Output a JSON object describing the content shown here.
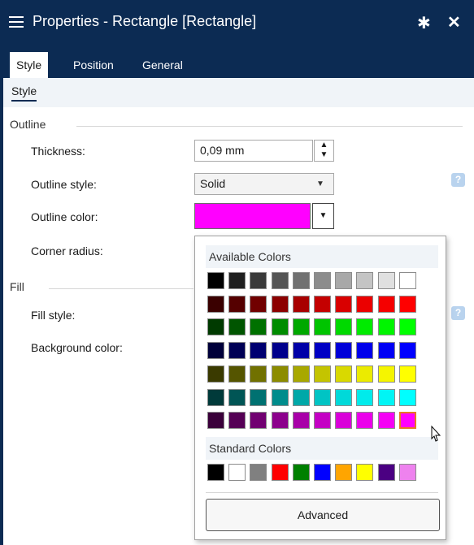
{
  "window": {
    "title": "Properties - Rectangle [Rectangle]",
    "pin_icon": "pin-icon",
    "close_icon": "close-icon"
  },
  "tabs": [
    {
      "label": "Style",
      "active": true
    },
    {
      "label": "Position",
      "active": false
    },
    {
      "label": "General",
      "active": false
    }
  ],
  "subtab": "Style",
  "outline": {
    "section_label": "Outline",
    "thickness_label": "Thickness:",
    "thickness_value": "0,09 mm",
    "style_label": "Outline style:",
    "style_value": "Solid",
    "color_label": "Outline color:",
    "color_value": "#ff00ff",
    "corner_label": "Corner radius:"
  },
  "fill": {
    "section_label": "Fill",
    "style_label": "Fill style:",
    "background_label": "Background color:"
  },
  "color_picker": {
    "available_label": "Available Colors",
    "standard_label": "Standard Colors",
    "advanced_label": "Advanced",
    "available_colors": [
      [
        "#000000",
        "#1f1f1f",
        "#3a3a3a",
        "#555555",
        "#717171",
        "#8c8c8c",
        "#a8a8a8",
        "#c4c4c4",
        "#e0e0e0",
        "#ffffff"
      ],
      [
        "#3a0000",
        "#550000",
        "#710000",
        "#8c0000",
        "#a80000",
        "#c40000",
        "#d90000",
        "#eb0000",
        "#f50000",
        "#ff0000"
      ],
      [
        "#003a00",
        "#005500",
        "#007100",
        "#008c00",
        "#00a800",
        "#00c400",
        "#00d900",
        "#00eb00",
        "#00f500",
        "#00ff00"
      ],
      [
        "#00003a",
        "#000055",
        "#000071",
        "#00008c",
        "#0000a8",
        "#0000c4",
        "#0000d9",
        "#0000eb",
        "#0000f5",
        "#0000ff"
      ],
      [
        "#3a3a00",
        "#555500",
        "#717100",
        "#8c8c00",
        "#a8a800",
        "#c4c400",
        "#d9d900",
        "#ebeb00",
        "#f5f500",
        "#ffff00"
      ],
      [
        "#003a3a",
        "#005555",
        "#007171",
        "#008c8c",
        "#00a8a8",
        "#00c4c4",
        "#00d9d9",
        "#00ebeb",
        "#00f5f5",
        "#00ffff"
      ],
      [
        "#3a003a",
        "#550055",
        "#710071",
        "#8c008c",
        "#a800a8",
        "#c400c4",
        "#d900d9",
        "#eb00eb",
        "#f500f5",
        "#ff00ff"
      ]
    ],
    "selected": [
      6,
      9
    ],
    "standard_colors": [
      "#000000",
      "#ffffff",
      "#808080",
      "#ff0000",
      "#008000",
      "#0000ff",
      "#ffa500",
      "#ffff00",
      "#4b0082",
      "#ee82ee"
    ]
  }
}
